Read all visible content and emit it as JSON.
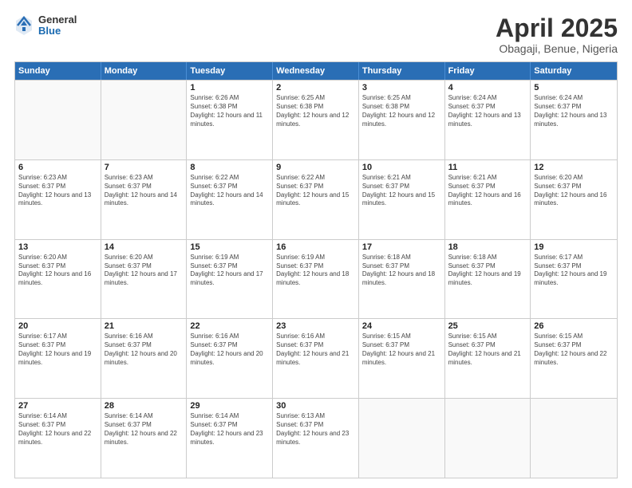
{
  "logo": {
    "general": "General",
    "blue": "Blue"
  },
  "header": {
    "title": "April 2025",
    "subtitle": "Obagaji, Benue, Nigeria"
  },
  "days": [
    "Sunday",
    "Monday",
    "Tuesday",
    "Wednesday",
    "Thursday",
    "Friday",
    "Saturday"
  ],
  "weeks": [
    [
      {
        "day": "",
        "text": ""
      },
      {
        "day": "",
        "text": ""
      },
      {
        "day": "1",
        "text": "Sunrise: 6:26 AM\nSunset: 6:38 PM\nDaylight: 12 hours and 11 minutes."
      },
      {
        "day": "2",
        "text": "Sunrise: 6:25 AM\nSunset: 6:38 PM\nDaylight: 12 hours and 12 minutes."
      },
      {
        "day": "3",
        "text": "Sunrise: 6:25 AM\nSunset: 6:38 PM\nDaylight: 12 hours and 12 minutes."
      },
      {
        "day": "4",
        "text": "Sunrise: 6:24 AM\nSunset: 6:37 PM\nDaylight: 12 hours and 13 minutes."
      },
      {
        "day": "5",
        "text": "Sunrise: 6:24 AM\nSunset: 6:37 PM\nDaylight: 12 hours and 13 minutes."
      }
    ],
    [
      {
        "day": "6",
        "text": "Sunrise: 6:23 AM\nSunset: 6:37 PM\nDaylight: 12 hours and 13 minutes."
      },
      {
        "day": "7",
        "text": "Sunrise: 6:23 AM\nSunset: 6:37 PM\nDaylight: 12 hours and 14 minutes."
      },
      {
        "day": "8",
        "text": "Sunrise: 6:22 AM\nSunset: 6:37 PM\nDaylight: 12 hours and 14 minutes."
      },
      {
        "day": "9",
        "text": "Sunrise: 6:22 AM\nSunset: 6:37 PM\nDaylight: 12 hours and 15 minutes."
      },
      {
        "day": "10",
        "text": "Sunrise: 6:21 AM\nSunset: 6:37 PM\nDaylight: 12 hours and 15 minutes."
      },
      {
        "day": "11",
        "text": "Sunrise: 6:21 AM\nSunset: 6:37 PM\nDaylight: 12 hours and 16 minutes."
      },
      {
        "day": "12",
        "text": "Sunrise: 6:20 AM\nSunset: 6:37 PM\nDaylight: 12 hours and 16 minutes."
      }
    ],
    [
      {
        "day": "13",
        "text": "Sunrise: 6:20 AM\nSunset: 6:37 PM\nDaylight: 12 hours and 16 minutes."
      },
      {
        "day": "14",
        "text": "Sunrise: 6:20 AM\nSunset: 6:37 PM\nDaylight: 12 hours and 17 minutes."
      },
      {
        "day": "15",
        "text": "Sunrise: 6:19 AM\nSunset: 6:37 PM\nDaylight: 12 hours and 17 minutes."
      },
      {
        "day": "16",
        "text": "Sunrise: 6:19 AM\nSunset: 6:37 PM\nDaylight: 12 hours and 18 minutes."
      },
      {
        "day": "17",
        "text": "Sunrise: 6:18 AM\nSunset: 6:37 PM\nDaylight: 12 hours and 18 minutes."
      },
      {
        "day": "18",
        "text": "Sunrise: 6:18 AM\nSunset: 6:37 PM\nDaylight: 12 hours and 19 minutes."
      },
      {
        "day": "19",
        "text": "Sunrise: 6:17 AM\nSunset: 6:37 PM\nDaylight: 12 hours and 19 minutes."
      }
    ],
    [
      {
        "day": "20",
        "text": "Sunrise: 6:17 AM\nSunset: 6:37 PM\nDaylight: 12 hours and 19 minutes."
      },
      {
        "day": "21",
        "text": "Sunrise: 6:16 AM\nSunset: 6:37 PM\nDaylight: 12 hours and 20 minutes."
      },
      {
        "day": "22",
        "text": "Sunrise: 6:16 AM\nSunset: 6:37 PM\nDaylight: 12 hours and 20 minutes."
      },
      {
        "day": "23",
        "text": "Sunrise: 6:16 AM\nSunset: 6:37 PM\nDaylight: 12 hours and 21 minutes."
      },
      {
        "day": "24",
        "text": "Sunrise: 6:15 AM\nSunset: 6:37 PM\nDaylight: 12 hours and 21 minutes."
      },
      {
        "day": "25",
        "text": "Sunrise: 6:15 AM\nSunset: 6:37 PM\nDaylight: 12 hours and 21 minutes."
      },
      {
        "day": "26",
        "text": "Sunrise: 6:15 AM\nSunset: 6:37 PM\nDaylight: 12 hours and 22 minutes."
      }
    ],
    [
      {
        "day": "27",
        "text": "Sunrise: 6:14 AM\nSunset: 6:37 PM\nDaylight: 12 hours and 22 minutes."
      },
      {
        "day": "28",
        "text": "Sunrise: 6:14 AM\nSunset: 6:37 PM\nDaylight: 12 hours and 22 minutes."
      },
      {
        "day": "29",
        "text": "Sunrise: 6:14 AM\nSunset: 6:37 PM\nDaylight: 12 hours and 23 minutes."
      },
      {
        "day": "30",
        "text": "Sunrise: 6:13 AM\nSunset: 6:37 PM\nDaylight: 12 hours and 23 minutes."
      },
      {
        "day": "",
        "text": ""
      },
      {
        "day": "",
        "text": ""
      },
      {
        "day": "",
        "text": ""
      }
    ]
  ]
}
